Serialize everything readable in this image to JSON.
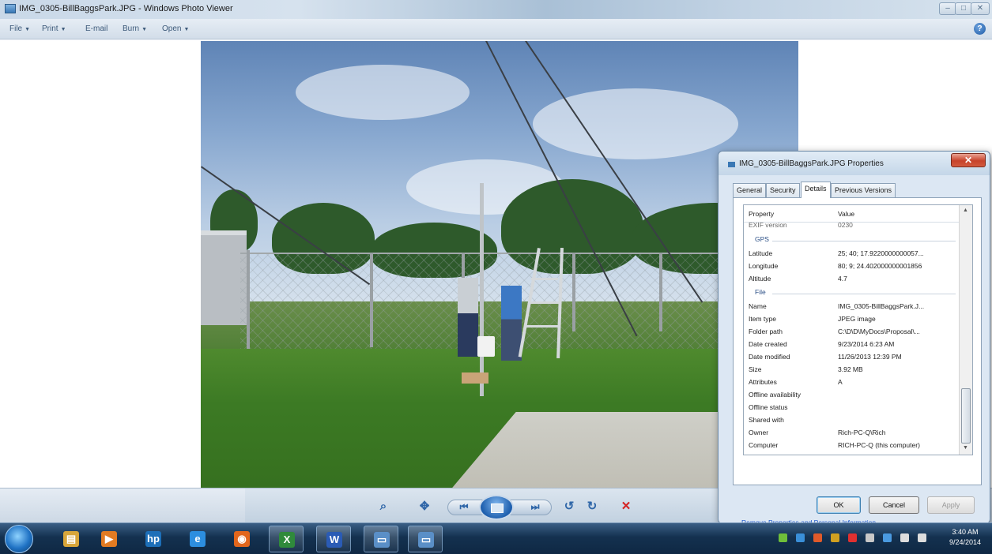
{
  "window": {
    "title": "IMG_0305-BillBaggsPark.JPG - Windows Photo Viewer",
    "caption_min": "–",
    "caption_max": "□",
    "caption_close": "✕"
  },
  "menu": {
    "items": [
      "File",
      "Print",
      "E-mail",
      "Burn",
      "Open"
    ],
    "caret": "▼",
    "help": "?"
  },
  "toolbar": {
    "zoom": "⌕",
    "fit": "✥",
    "prev": "⏮",
    "next": "⏭",
    "rotate_ccw": "↺",
    "rotate_cw": "↻",
    "delete": "✕"
  },
  "dialog": {
    "title": "IMG_0305-BillBaggsPark.JPG Properties",
    "close": "✕",
    "tabs": [
      "General",
      "Security",
      "Details",
      "Previous Versions"
    ],
    "active_tab": "Details",
    "columns": {
      "property": "Property",
      "value": "Value"
    },
    "partial_row": {
      "name": "EXIF version",
      "value": "0230"
    },
    "groups": {
      "gps": {
        "label": "GPS",
        "rows": [
          {
            "name": "Latitude",
            "value": "25; 40; 17.9220000000057..."
          },
          {
            "name": "Longitude",
            "value": "80; 9; 24.402000000001856"
          },
          {
            "name": "Altitude",
            "value": "4.7"
          }
        ]
      },
      "file": {
        "label": "File",
        "rows": [
          {
            "name": "Name",
            "value": "IMG_0305-BillBaggsPark.J..."
          },
          {
            "name": "Item type",
            "value": "JPEG image"
          },
          {
            "name": "Folder path",
            "value": "C:\\D\\D\\MyDocs\\Proposal\\..."
          },
          {
            "name": "Date created",
            "value": "9/23/2014 6:23 AM"
          },
          {
            "name": "Date modified",
            "value": "11/26/2013 12:39 PM"
          },
          {
            "name": "Size",
            "value": "3.92 MB"
          },
          {
            "name": "Attributes",
            "value": "A"
          },
          {
            "name": "Offline availability",
            "value": ""
          },
          {
            "name": "Offline status",
            "value": ""
          },
          {
            "name": "Shared with",
            "value": ""
          },
          {
            "name": "Owner",
            "value": "Rich-PC-Q\\Rich"
          },
          {
            "name": "Computer",
            "value": "RICH-PC-Q (this computer)"
          }
        ]
      }
    },
    "remove_link": "Remove Properties and Personal Information",
    "buttons": {
      "ok": "OK",
      "cancel": "Cancel",
      "apply": "Apply"
    },
    "scroll_up": "▲",
    "scroll_down": "▼"
  },
  "taskbar": {
    "apps": [
      {
        "icon": "explorer-icon",
        "glyph": "▤",
        "color": "#d8a63a"
      },
      {
        "icon": "media-player-icon",
        "glyph": "▶",
        "color": "#e27b22"
      },
      {
        "icon": "hp-icon",
        "glyph": "hp",
        "color": "#1d6fb8"
      },
      {
        "icon": "internet-explorer-icon",
        "glyph": "e",
        "color": "#2c8ee0"
      },
      {
        "icon": "firefox-icon",
        "glyph": "◉",
        "color": "#e2661c"
      },
      {
        "icon": "excel-icon",
        "glyph": "X",
        "color": "#2f8a3b"
      },
      {
        "icon": "word-icon",
        "glyph": "W",
        "color": "#2a5bb5"
      },
      {
        "icon": "photo-viewer-icon",
        "glyph": "▭",
        "color": "#5a8fc7"
      },
      {
        "icon": "photo-viewer-icon-2",
        "glyph": "▭",
        "color": "#5a8fc7"
      }
    ],
    "tray_colors": [
      "#6fbf3a",
      "#3a8fd8",
      "#e05a2a",
      "#d0a020",
      "#e03030",
      "#c8c8c8",
      "#4a9ae0",
      "#dddddd",
      "#dddddd"
    ],
    "clock_time": "3:40 AM",
    "clock_date": "9/24/2014"
  }
}
